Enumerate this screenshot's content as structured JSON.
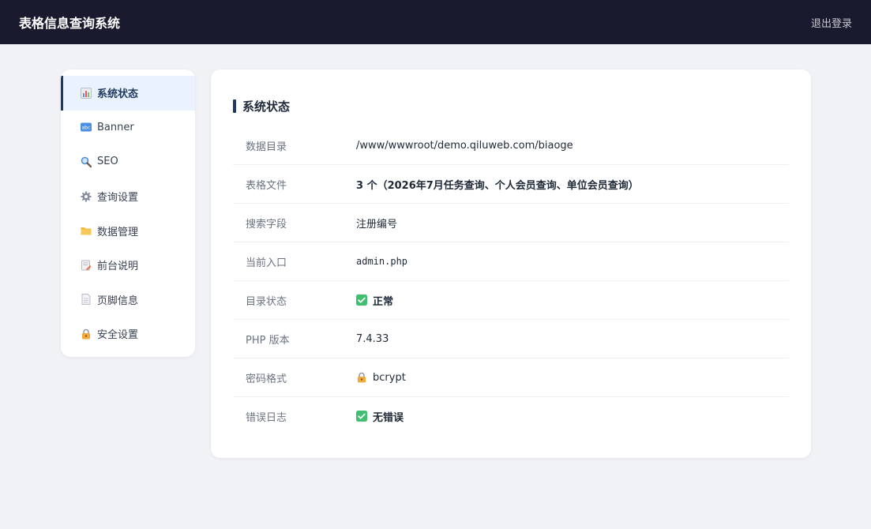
{
  "header": {
    "title": "表格信息查询系统",
    "logout_label": "退出登录"
  },
  "sidebar": {
    "items": [
      {
        "label": "系统状态",
        "icon": "bar-chart-icon",
        "active": true
      },
      {
        "label": "Banner",
        "icon": "abc-icon",
        "active": false
      },
      {
        "label": "SEO",
        "icon": "magnifier-icon",
        "active": false
      },
      {
        "label": "查询设置",
        "icon": "gear-icon",
        "active": false
      },
      {
        "label": "数据管理",
        "icon": "folder-icon",
        "active": false
      },
      {
        "label": "前台说明",
        "icon": "memo-icon",
        "active": false
      },
      {
        "label": "页脚信息",
        "icon": "page-icon",
        "active": false
      },
      {
        "label": "安全设置",
        "icon": "lock-icon",
        "active": false
      }
    ]
  },
  "main": {
    "title": "系统状态",
    "rows": [
      {
        "label": "数据目录",
        "value": "/www/wwwroot/demo.qiluweb.com/biaoge"
      },
      {
        "label": "表格文件",
        "value": "3 个（2026年7月任务查询、个人会员查询、单位会员查询）"
      },
      {
        "label": "搜索字段",
        "value": "注册编号"
      },
      {
        "label": "当前入口",
        "value": "admin.php"
      },
      {
        "label": "目录状态",
        "value": "正常",
        "icon": "check-icon"
      },
      {
        "label": "PHP 版本",
        "value": "7.4.33"
      },
      {
        "label": "密码格式",
        "value": "bcrypt",
        "icon": "lock-icon"
      },
      {
        "label": "错误日志",
        "value": "无错误",
        "icon": "check-icon"
      }
    ]
  },
  "colors": {
    "topbar": "#1a1a2e",
    "accent": "#1e3a5f",
    "active_bg": "#eaf2fd",
    "check_green": "#3fbf6f"
  }
}
